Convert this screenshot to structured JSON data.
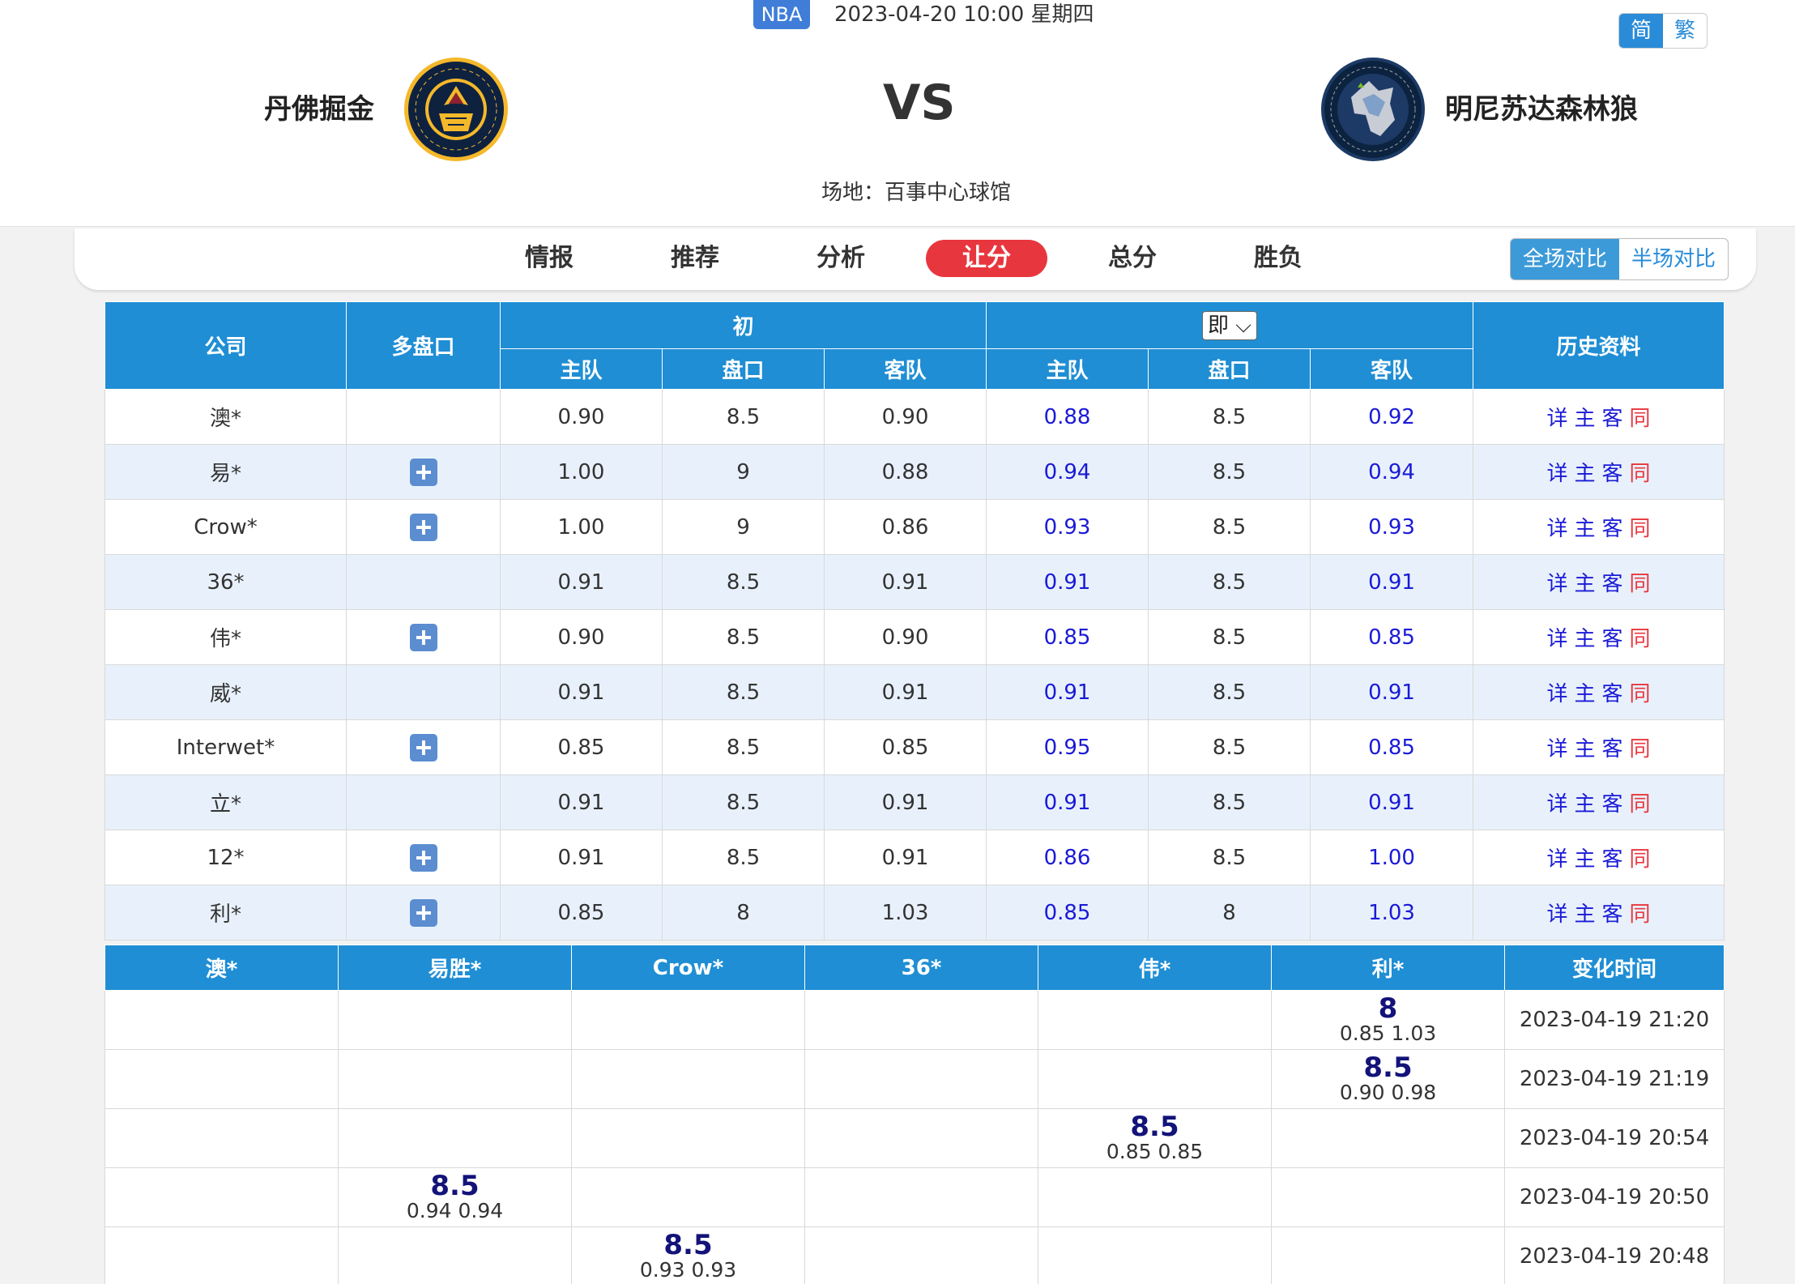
{
  "header": {
    "league": "NBA",
    "datetime": "2023-04-20 10:00 星期四",
    "lang": [
      "简",
      "繁"
    ],
    "home_team": "丹佛掘金",
    "away_team": "明尼苏达森林狼",
    "vs": "VS",
    "venue": "场地：百事中心球馆"
  },
  "nav": {
    "items": [
      "情报",
      "推荐",
      "分析",
      "让分",
      "总分",
      "胜负"
    ],
    "active": "让分",
    "compare": [
      "全场对比",
      "半场对比"
    ]
  },
  "odds_table": {
    "headers": {
      "company": "公司",
      "multi": "多盘口",
      "initial": "初",
      "live": "即",
      "history": "历史资料",
      "home": "主队",
      "line": "盘口",
      "away": "客队"
    },
    "history_links": [
      "详",
      "主",
      "客",
      "同"
    ],
    "rows": [
      {
        "company": "澳*",
        "init_home": "0.90",
        "init_line": "8.5",
        "init_away": "0.90",
        "live_home": "0.88",
        "live_line": "8.5",
        "live_away": "0.92"
      },
      {
        "company": "易*",
        "init_home": "1.00",
        "init_line": "9",
        "init_away": "0.88",
        "live_home": "0.94",
        "live_line": "8.5",
        "live_away": "0.94"
      },
      {
        "company": "Crow*",
        "init_home": "1.00",
        "init_line": "9",
        "init_away": "0.86",
        "live_home": "0.93",
        "live_line": "8.5",
        "live_away": "0.93"
      },
      {
        "company": "36*",
        "init_home": "0.91",
        "init_line": "8.5",
        "init_away": "0.91",
        "live_home": "0.91",
        "live_line": "8.5",
        "live_away": "0.91"
      },
      {
        "company": "伟*",
        "init_home": "0.90",
        "init_line": "8.5",
        "init_away": "0.90",
        "live_home": "0.85",
        "live_line": "8.5",
        "live_away": "0.85"
      },
      {
        "company": "威*",
        "init_home": "0.91",
        "init_line": "8.5",
        "init_away": "0.91",
        "live_home": "0.91",
        "live_line": "8.5",
        "live_away": "0.91"
      },
      {
        "company": "Interwet*",
        "init_home": "0.85",
        "init_line": "8.5",
        "init_away": "0.85",
        "live_home": "0.95",
        "live_line": "8.5",
        "live_away": "0.85"
      },
      {
        "company": "立*",
        "init_home": "0.91",
        "init_line": "8.5",
        "init_away": "0.91",
        "live_home": "0.91",
        "live_line": "8.5",
        "live_away": "0.91"
      },
      {
        "company": "12*",
        "init_home": "0.91",
        "init_line": "8.5",
        "init_away": "0.91",
        "live_home": "0.86",
        "live_line": "8.5",
        "live_away": "1.00"
      },
      {
        "company": "利*",
        "init_home": "0.85",
        "init_line": "8",
        "init_away": "1.03",
        "live_home": "0.85",
        "live_line": "8",
        "live_away": "1.03"
      }
    ]
  },
  "change_table": {
    "headers": [
      "澳*",
      "易胜*",
      "Crow*",
      "36*",
      "伟*",
      "利*",
      "变化时间"
    ],
    "rows": [
      {
        "col": 5,
        "line": "8",
        "odds": "0.85  1.03",
        "time": "2023-04-19 21:20"
      },
      {
        "col": 5,
        "line": "8.5",
        "odds": "0.90  0.98",
        "time": "2023-04-19 21:19"
      },
      {
        "col": 4,
        "line": "8.5",
        "odds": "0.85  0.85",
        "time": "2023-04-19 20:54"
      },
      {
        "col": 1,
        "line": "8.5",
        "odds": "0.94  0.94",
        "time": "2023-04-19 20:50"
      },
      {
        "col": 2,
        "line": "8.5",
        "odds": "0.93  0.93",
        "time": "2023-04-19 20:48"
      }
    ]
  },
  "colors": {
    "header_blue": "#1f8ed4",
    "active_red": "#e8363e",
    "live_blue": "#1a1ad6",
    "row_alt": "#e8f1fb"
  }
}
